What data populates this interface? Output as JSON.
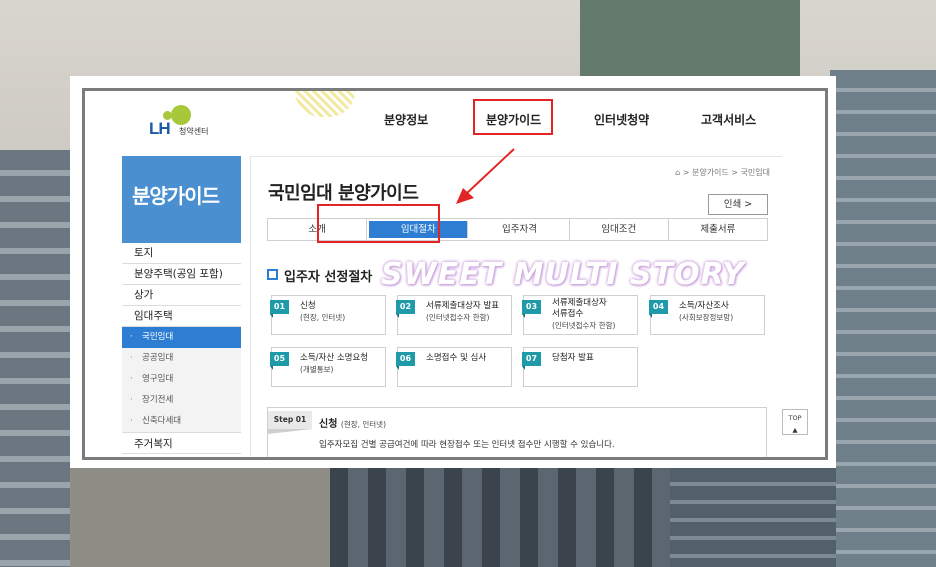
{
  "header": {
    "logo_mark": "LH",
    "logo_sub": "청약센터",
    "nav": [
      "분양정보",
      "분양가이드",
      "인터넷청약",
      "고객서비스"
    ]
  },
  "sidebar": {
    "title": "분양가이드",
    "items": [
      "토지",
      "분양주택(공임 포함)",
      "상가",
      "임대주택"
    ],
    "sub_items": [
      "국민임대",
      "공공임대",
      "영구임대",
      "장기전세",
      "신축다세대"
    ],
    "last_item": "주거복지"
  },
  "main": {
    "breadcrumb": "분양가이드 > 국민임대",
    "title": "국민임대 분양가이드",
    "print_label": "인쇄",
    "tabs": [
      "소개",
      "임대절차",
      "입주자격",
      "임대조건",
      "제출서류"
    ],
    "section_title": "입주자 선정절차",
    "watermark": "SWEET MULTI STORY",
    "steps": [
      {
        "num": "01",
        "line1": "신청",
        "line2": "(현장, 인터넷)"
      },
      {
        "num": "02",
        "line1": "서류제출대상자 발표",
        "line2": "(인터넷접수자 한함)"
      },
      {
        "num": "03",
        "line1": "서류제출대상자",
        "line2": "서류접수",
        "line3": "(인터넷접수자 한함)"
      },
      {
        "num": "04",
        "line1": "소득/자산조사",
        "line2": "(사회보장정보망)"
      },
      {
        "num": "05",
        "line1": "소득/자산 소명요청",
        "line2": "(개별통보)"
      },
      {
        "num": "06",
        "line1": "소명접수 및 심사"
      },
      {
        "num": "07",
        "line1": "당첨자 발표"
      }
    ],
    "step_detail": {
      "label": "Step 01",
      "title": "신청",
      "title_sub": "(현장, 인터넷)",
      "desc": "입주자모집 건별 공급여건에 따라 현장접수 또는 인터넷 접수만 시행할 수 있습니다."
    },
    "top_label": "TOP"
  },
  "colors": {
    "accent": "#2d7dd2",
    "step_badge": "#1f9aa8",
    "annotation": "#e32424"
  }
}
